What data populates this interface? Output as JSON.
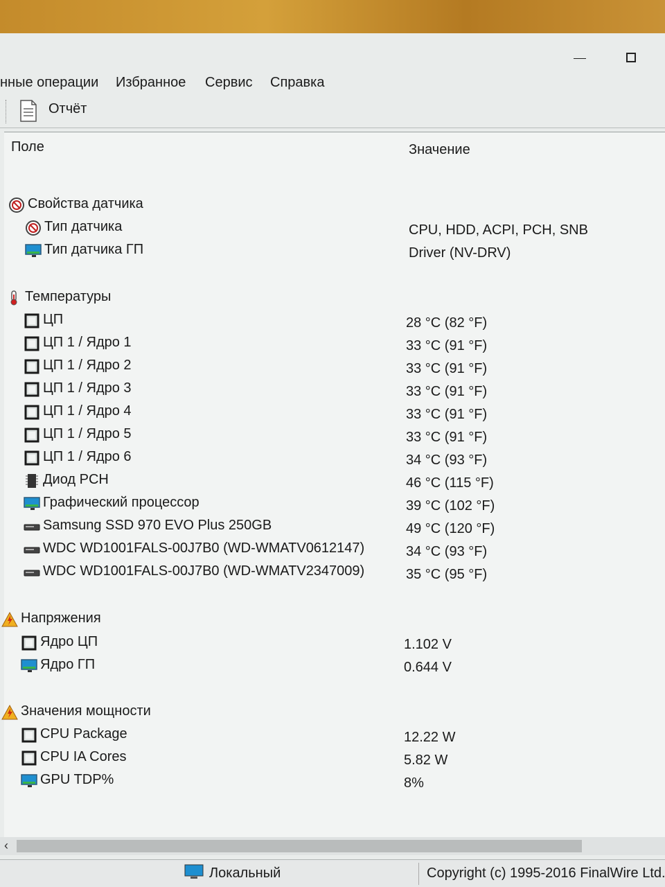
{
  "menu": [
    "нные операции",
    "Избранное",
    "Сервис",
    "Справка"
  ],
  "toolbar": {
    "report_label": "Отчёт"
  },
  "columns": {
    "field": "Поле",
    "value": "Значение"
  },
  "groups": {
    "sensor": {
      "title": "Свойства датчика",
      "rows": [
        {
          "label": "Тип датчика",
          "value": "CPU, HDD, ACPI, PCH, SNB",
          "icon": "sensor-icon"
        },
        {
          "label": "Тип датчика ГП",
          "value": "Driver  (NV-DRV)",
          "icon": "monitor-icon"
        }
      ]
    },
    "temps": {
      "title": "Температуры",
      "rows": [
        {
          "label": "ЦП",
          "value": "28 °C  (82 °F)",
          "icon": "chip-icon"
        },
        {
          "label": "ЦП 1 / Ядро 1",
          "value": "33 °C  (91 °F)",
          "icon": "chip-icon"
        },
        {
          "label": "ЦП 1 / Ядро 2",
          "value": "33 °C  (91 °F)",
          "icon": "chip-icon"
        },
        {
          "label": "ЦП 1 / Ядро 3",
          "value": "33 °C  (91 °F)",
          "icon": "chip-icon"
        },
        {
          "label": "ЦП 1 / Ядро 4",
          "value": "33 °C  (91 °F)",
          "icon": "chip-icon"
        },
        {
          "label": "ЦП 1 / Ядро 5",
          "value": "33 °C  (91 °F)",
          "icon": "chip-icon"
        },
        {
          "label": "ЦП 1 / Ядро 6",
          "value": "34 °C  (93 °F)",
          "icon": "chip-icon"
        },
        {
          "label": "Диод PCH",
          "value": "46 °C  (115 °F)",
          "icon": "pch-icon"
        },
        {
          "label": "Графический процессор",
          "value": "39 °C  (102 °F)",
          "icon": "monitor-icon"
        },
        {
          "label": "Samsung SSD 970 EVO Plus 250GB",
          "value": "49 °C  (120 °F)",
          "icon": "disk-icon"
        },
        {
          "label": "WDC WD1001FALS-00J7B0 (WD-WMATV0612147)",
          "value": "34 °C  (93 °F)",
          "icon": "disk-icon"
        },
        {
          "label": "WDC WD1001FALS-00J7B0 (WD-WMATV2347009)",
          "value": "35 °C  (95 °F)",
          "icon": "disk-icon"
        }
      ]
    },
    "volts": {
      "title": "Напряжения",
      "rows": [
        {
          "label": "Ядро ЦП",
          "value": "1.102 V",
          "icon": "chip-icon"
        },
        {
          "label": "Ядро ГП",
          "value": "0.644 V",
          "icon": "monitor-icon"
        }
      ]
    },
    "power": {
      "title": "Значения мощности",
      "rows": [
        {
          "label": "CPU Package",
          "value": "12.22 W",
          "icon": "chip-icon"
        },
        {
          "label": "CPU IA Cores",
          "value": "5.82 W",
          "icon": "chip-icon"
        },
        {
          "label": "GPU TDP%",
          "value": "8%",
          "icon": "monitor-icon"
        }
      ]
    }
  },
  "status": {
    "local": "Локальный",
    "copyright": "Copyright (c) 1995-2016 FinalWire Ltd."
  },
  "colors": {
    "warning": "#f0b020",
    "thermo": "#d02020",
    "monitor": "#1e8fd0",
    "chip": "#1a1a1a"
  }
}
